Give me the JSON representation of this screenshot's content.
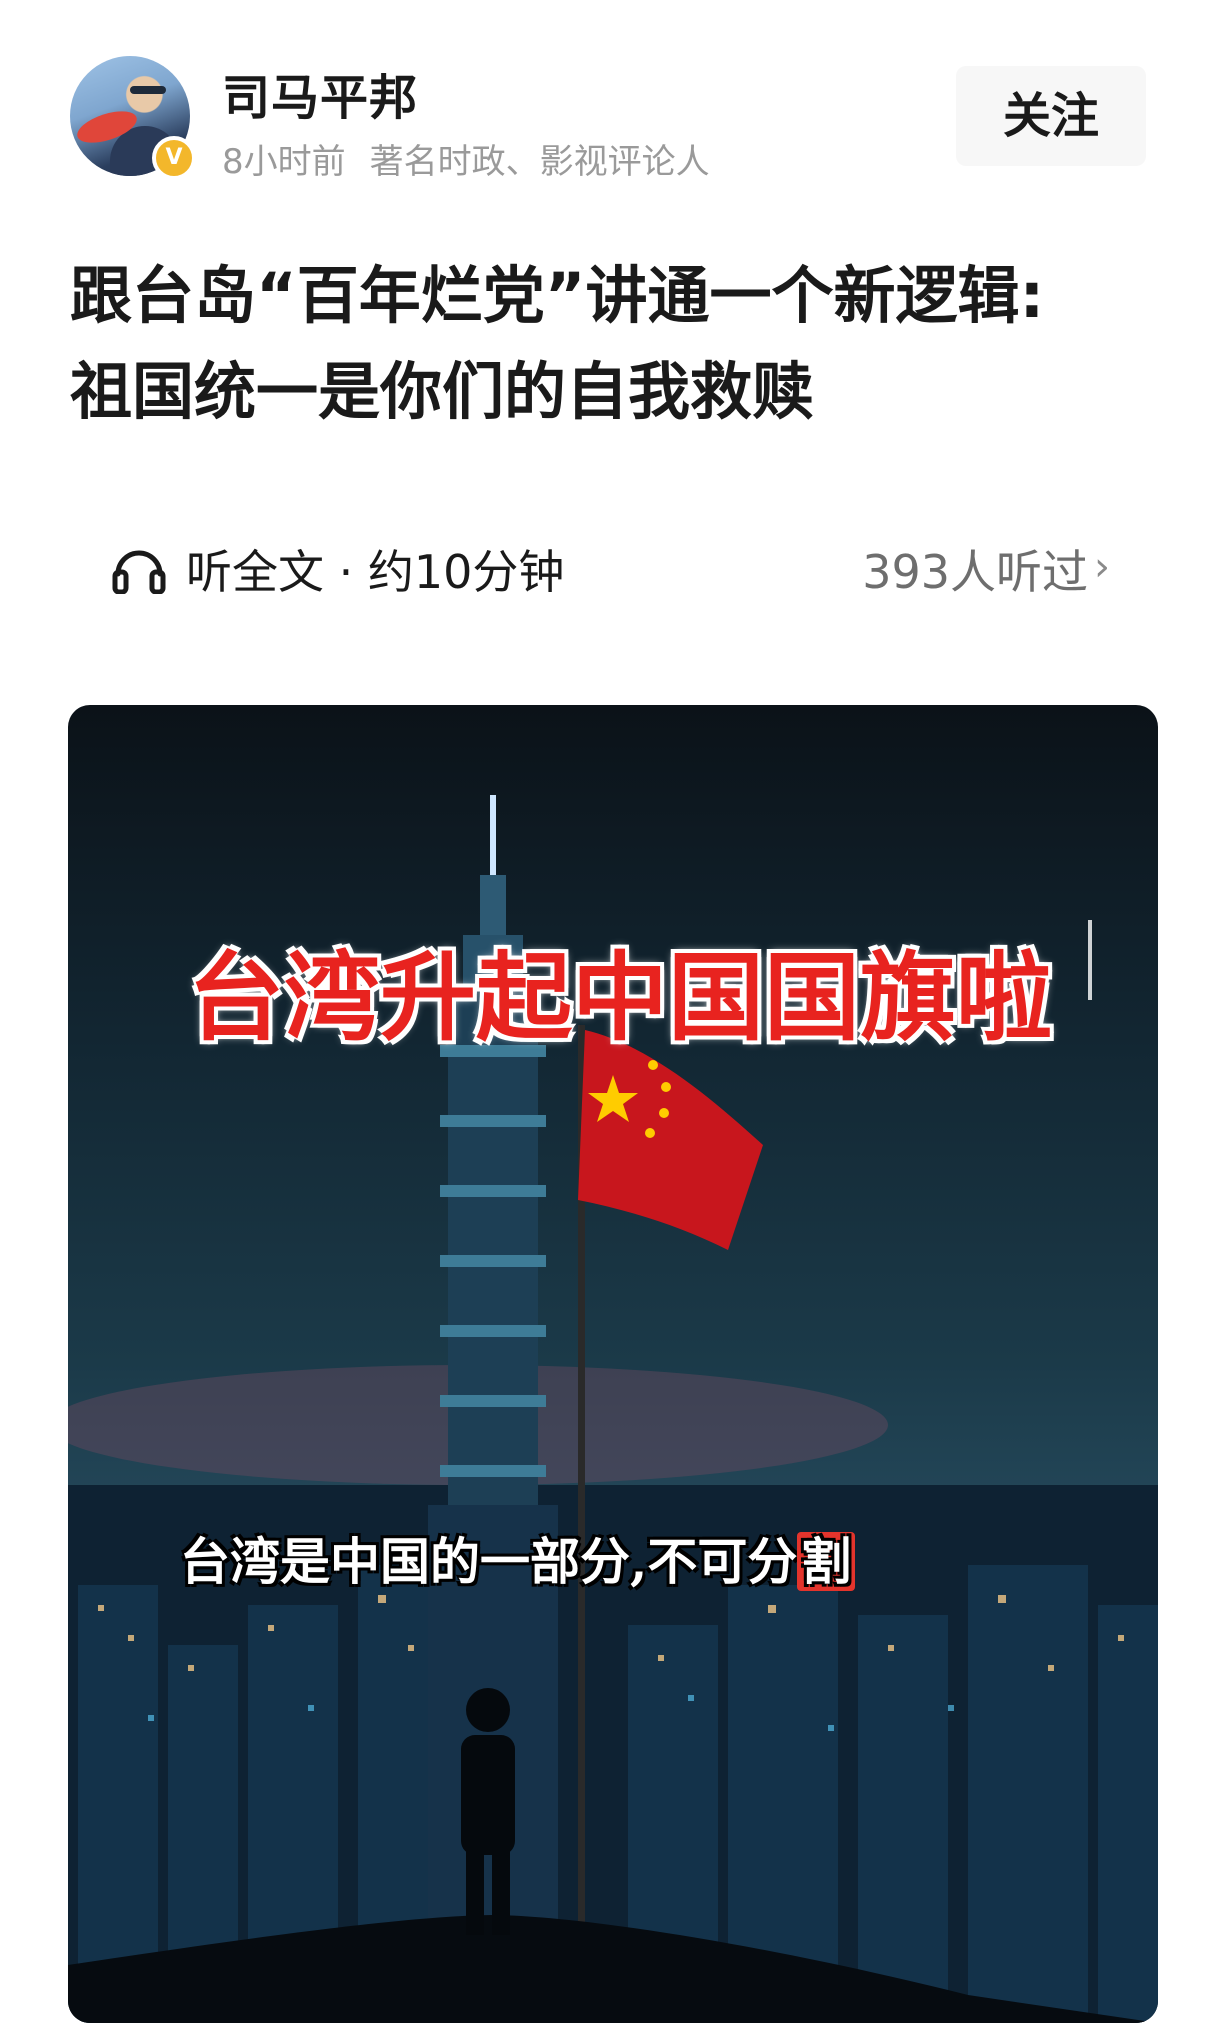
{
  "author": {
    "name": "司马平邦",
    "time": "8小时前",
    "description": "著名时政、影视评论人",
    "badge": "V"
  },
  "follow_label": "关注",
  "article": {
    "title_line1": "跟台岛“百年烂党”讲通一个新逻辑:",
    "title_line2": "祖国统一是你们的自我救赎"
  },
  "audio": {
    "icon": "headphone-icon",
    "label": "听全文 · 约10分钟",
    "listen_count": "393人听过",
    "chevron": "›"
  },
  "hero_image": {
    "headline": "台湾升起中国国旗啦",
    "caption_main": "台湾是中国的一部分,不可分",
    "caption_highlight": "割"
  },
  "colors": {
    "headline_red": "#e8231f",
    "badge_yellow": "#f3b72b",
    "follow_bg": "#f7f7f7"
  }
}
